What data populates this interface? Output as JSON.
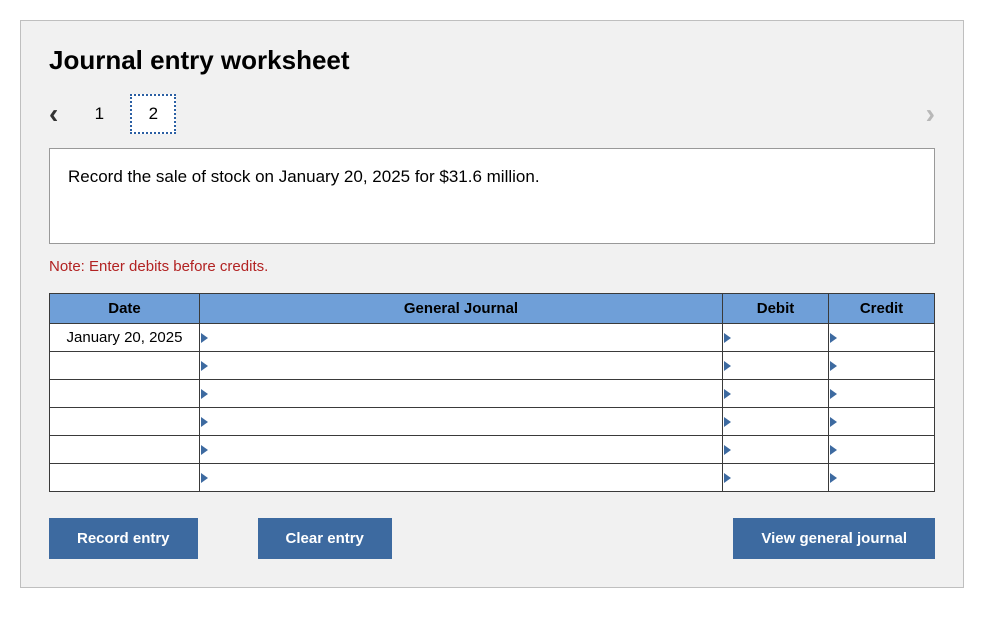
{
  "title": "Journal entry worksheet",
  "pager": {
    "pages": [
      "1",
      "2"
    ],
    "active_index": 1
  },
  "instruction": "Record the sale of stock on January 20, 2025 for $31.6 million.",
  "note": "Note: Enter debits before credits.",
  "table": {
    "headers": {
      "date": "Date",
      "gj": "General Journal",
      "debit": "Debit",
      "credit": "Credit"
    },
    "rows": [
      {
        "date": "January 20, 2025",
        "gj": "",
        "debit": "",
        "credit": ""
      },
      {
        "date": "",
        "gj": "",
        "debit": "",
        "credit": ""
      },
      {
        "date": "",
        "gj": "",
        "debit": "",
        "credit": ""
      },
      {
        "date": "",
        "gj": "",
        "debit": "",
        "credit": ""
      },
      {
        "date": "",
        "gj": "",
        "debit": "",
        "credit": ""
      },
      {
        "date": "",
        "gj": "",
        "debit": "",
        "credit": ""
      }
    ]
  },
  "buttons": {
    "record": "Record entry",
    "clear": "Clear entry",
    "view": "View general journal"
  }
}
